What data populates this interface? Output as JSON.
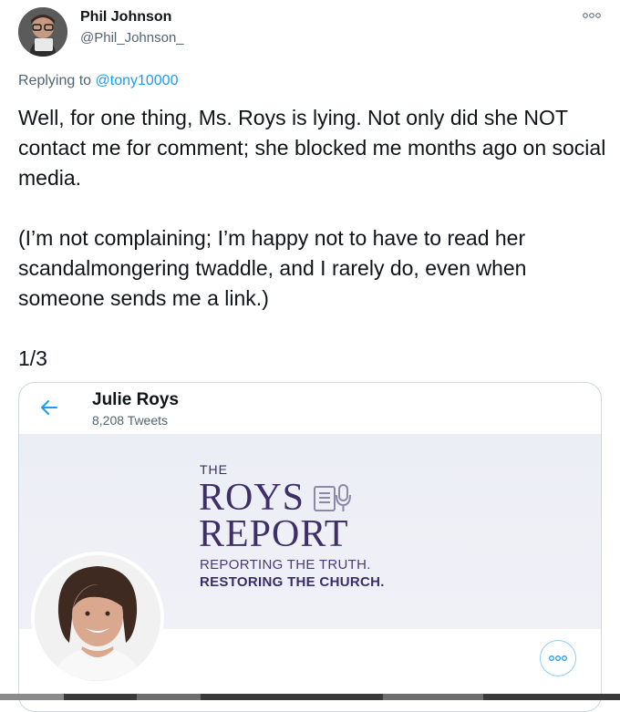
{
  "tweet": {
    "author_name": "Phil Johnson",
    "author_handle": "@Phil_Johnson_",
    "replying_prefix": "Replying to",
    "replying_to": "@tony10000",
    "paragraphs": [
      "Well, for one thing, Ms. Roys is lying. Not only did she NOT contact me for comment; she blocked me months ago on social media.",
      "(I’m not complaining; I’m happy not to have to read her scandalmongering twaddle, and I rarely do, even when someone sends me a link.)",
      "1/3"
    ],
    "more_icon": "more-dots-icon"
  },
  "embedded": {
    "name": "Julie Roys",
    "tweet_count": "8,208 Tweets",
    "back_icon": "back-arrow-icon",
    "banner": {
      "line_the": "THE",
      "line_roys": "ROYS",
      "line_report": "REPORT",
      "tagline_1": "REPORTING THE TRUTH.",
      "tagline_2": "RESTORING THE CHURCH."
    },
    "more_icon": "more-dots-icon"
  },
  "colors": {
    "link": "#1d9bf0",
    "secondary_text": "#536471",
    "banner_purple": "#3e2f68",
    "border": "#cfd9de"
  }
}
